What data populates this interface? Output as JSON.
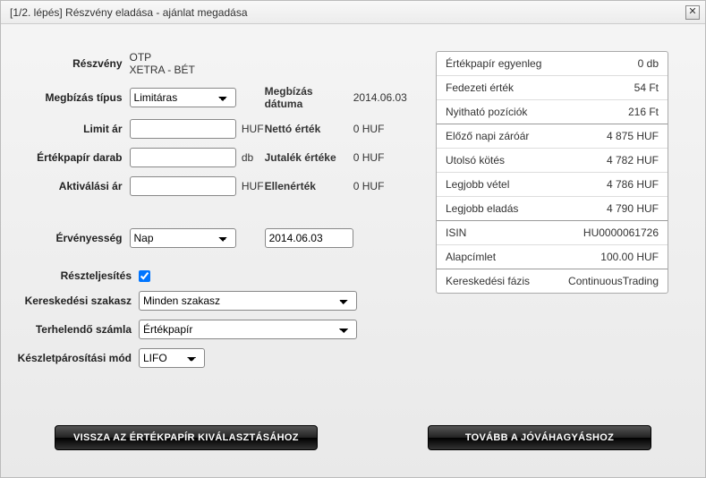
{
  "window": {
    "title": "[1/2. lépés] Részvény eladása - ajánlat megadása"
  },
  "form": {
    "stock_label": "Részvény",
    "stock_code": "OTP",
    "stock_market": "XETRA - BÉT",
    "order_type_label": "Megbízás típus",
    "order_type_value": "Limitáras",
    "limit_price_label": "Limit ár",
    "limit_price_value": "",
    "limit_price_unit": "HUF",
    "qty_label": "Értékpapír darab",
    "qty_value": "",
    "qty_unit": "db",
    "activation_label": "Aktiválási ár",
    "activation_value": "",
    "activation_unit": "HUF",
    "validity_label": "Érvényesség",
    "validity_value": "Nap",
    "validity_date": "2014.06.03",
    "partial_label": "Részteljesítés",
    "trading_phase_label": "Kereskedési szakasz",
    "trading_phase_value": "Minden szakasz",
    "account_label": "Terhelendő számla",
    "account_value": "Értékpapír",
    "matching_label": "Készletpárosítási mód",
    "matching_value": "LIFO",
    "date_label": "Megbízás dátuma",
    "date_value": "2014.06.03",
    "net_label": "Nettó érték",
    "net_value": "0 HUF",
    "commission_label": "Jutalék értéke",
    "commission_value": "0 HUF",
    "total_label": "Ellenérték",
    "total_value": "0 HUF"
  },
  "panel": {
    "rows_top": [
      {
        "k": "Értékpapír egyenleg",
        "v": "0 db"
      },
      {
        "k": "Fedezeti érték",
        "v": "54 Ft"
      },
      {
        "k": "Nyitható pozíciók",
        "v": "216 Ft"
      }
    ],
    "rows_mid": [
      {
        "k": "Előző napi záróár",
        "v": "4 875 HUF"
      },
      {
        "k": "Utolsó kötés",
        "v": "4 782 HUF"
      },
      {
        "k": "Legjobb vétel",
        "v": "4 786 HUF"
      },
      {
        "k": "Legjobb eladás",
        "v": "4 790 HUF"
      }
    ],
    "rows_bot": [
      {
        "k": "ISIN",
        "v": "HU0000061726"
      },
      {
        "k": "Alapcímlet",
        "v": "100.00 HUF"
      }
    ],
    "rows_last": [
      {
        "k": "Kereskedési fázis",
        "v": "ContinuousTrading"
      }
    ]
  },
  "buttons": {
    "back": "VISSZA AZ ÉRTÉKPAPÍR KIVÁLASZTÁSÁHOZ",
    "next": "TOVÁBB A JÓVÁHAGYÁSHOZ"
  }
}
